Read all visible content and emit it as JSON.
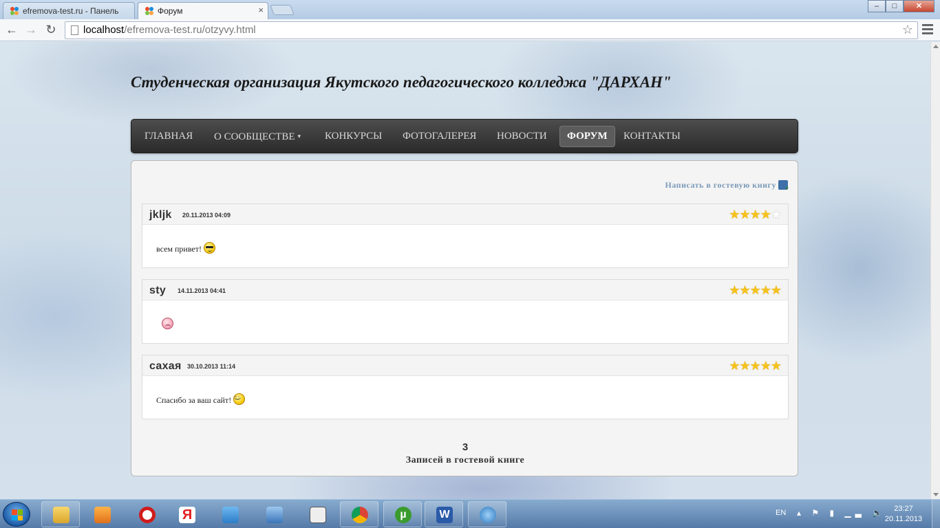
{
  "browser": {
    "tabs": [
      {
        "title": "efremova-test.ru - Панель",
        "active": false
      },
      {
        "title": "Форум",
        "active": true
      }
    ],
    "url_host": "localhost",
    "url_path": "/efremova-test.ru/otzyvy.html",
    "window_controls": {
      "minimize": "‒",
      "maximize": "□",
      "close": "✕"
    }
  },
  "site": {
    "title": "Студенческая организация Якутского педагогического колледжа \"ДАРХАН\"",
    "nav": [
      {
        "label": "ГЛАВНАЯ",
        "active": false
      },
      {
        "label": "О СООБЩЕСТВЕ",
        "active": false,
        "has_dropdown": true
      },
      {
        "label": "КОНКУРСЫ",
        "active": false
      },
      {
        "label": "ФОТОГАЛЕРЕЯ",
        "active": false
      },
      {
        "label": "НОВОСТИ",
        "active": false
      },
      {
        "label": "ФОРУМ",
        "active": true
      },
      {
        "label": "КОНТАКТЫ",
        "active": false
      }
    ]
  },
  "guestbook": {
    "write_link": "Написать в гостевую книгу",
    "entries": [
      {
        "author": "jkljk",
        "date": "20.11.2013 04:09",
        "rating": 4,
        "max_rating": 5,
        "message": "всем привет!",
        "smiley": "cool-smiley"
      },
      {
        "author": "sty",
        "date": "14.11.2013 04:41",
        "rating": 5,
        "max_rating": 5,
        "message": "",
        "smiley": "sad-smiley"
      },
      {
        "author": "сахая",
        "date": "30.10.2013 11:14",
        "rating": 5,
        "max_rating": 5,
        "message": "Спасибо за ваш сайт!",
        "smiley": "wink-smiley"
      }
    ],
    "count": "3",
    "count_label": "Записей в гостевой книге"
  },
  "taskbar": {
    "apps": [
      "explorer-icon",
      "media-player-icon",
      "opera-icon",
      "yandex-icon",
      "mail-icon",
      "audio-icon",
      "calculator-icon",
      "chrome-icon",
      "utorrent-icon",
      "word-icon",
      "download-icon"
    ],
    "language": "EN",
    "time": "23:27",
    "date": "20.11.2013"
  },
  "colors": {
    "nav_bg": "#333333",
    "accent_link": "#7a9ab8",
    "star": "#f6c21c"
  }
}
